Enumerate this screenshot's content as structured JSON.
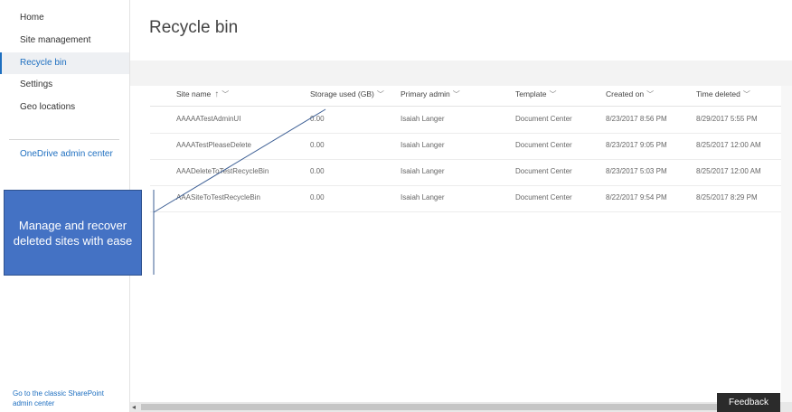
{
  "nav": {
    "items": [
      {
        "label": "Home"
      },
      {
        "label": "Site management"
      },
      {
        "label": "Recycle bin"
      },
      {
        "label": "Settings"
      },
      {
        "label": "Geo locations"
      }
    ],
    "onedrive_link": "OneDrive admin center",
    "classic_link": "Go to the classic SharePoint admin center",
    "accent_color": "#1e6fc0"
  },
  "page": {
    "title": "Recycle bin"
  },
  "table": {
    "columns": [
      {
        "label": "Site name",
        "sorted": "ascending"
      },
      {
        "label": "Storage used (GB)"
      },
      {
        "label": "Primary admin"
      },
      {
        "label": "Template"
      },
      {
        "label": "Created on"
      },
      {
        "label": "Time deleted"
      }
    ],
    "rows": [
      [
        "AAAAATestAdminUI",
        "0.00",
        "Isaiah Langer",
        "Document Center",
        "8/23/2017 8:56 PM",
        "8/29/2017 5:55 PM"
      ],
      [
        "AAAATestPleaseDelete",
        "0.00",
        "Isaiah Langer",
        "Document Center",
        "8/23/2017 9:05 PM",
        "8/25/2017 12:00 AM"
      ],
      [
        "AAADeleteToTestRecycleBin",
        "0.00",
        "Isaiah Langer",
        "Document Center",
        "8/23/2017 5:03 PM",
        "8/25/2017 12:00 AM"
      ],
      [
        "AAASiteToTestRecycleBin",
        "0.00",
        "Isaiah Langer",
        "Document Center",
        "8/22/2017 9:54 PM",
        "8/25/2017 8:29 PM"
      ]
    ]
  },
  "feedback_label": "Feedback",
  "callout": {
    "text": "Manage and recover deleted sites  with ease",
    "color": "#4472c4"
  },
  "icons": {
    "sort": "arrow-up-icon",
    "column_menu": "chevron-down-icon",
    "scroll_left": "chevron-left-icon"
  }
}
